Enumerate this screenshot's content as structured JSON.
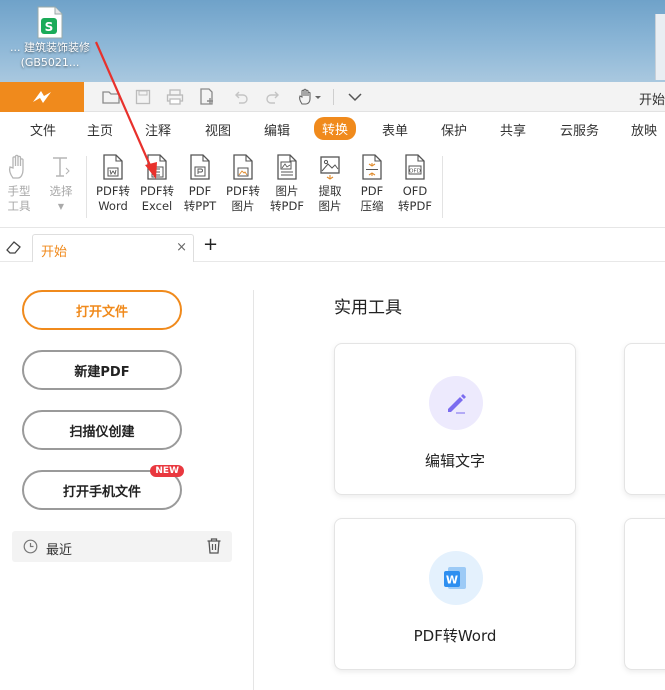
{
  "desktop": {
    "icon_label_line1": "建筑装饰装修",
    "icon_label_line2": "(GB5021...",
    "left_truncated": "..."
  },
  "titlebar": {
    "right_text": "开始"
  },
  "menu": {
    "items": [
      "文件",
      "主页",
      "注释",
      "视图",
      "编辑",
      "转换",
      "表单",
      "保护",
      "共享",
      "云服务",
      "放映"
    ],
    "active": "转换"
  },
  "toolbar": {
    "tools": [
      {
        "line1": "手型",
        "line2": "工具",
        "icon": "hand-icon",
        "disabled": true
      },
      {
        "line1": "选择",
        "line2": "",
        "icon": "text-select-icon",
        "disabled": true
      },
      {
        "line1": "PDF转",
        "line2": "Word",
        "icon": "pdf-to-word-icon"
      },
      {
        "line1": "PDF转",
        "line2": "Excel",
        "icon": "pdf-to-excel-icon"
      },
      {
        "line1": "PDF",
        "line2": "转PPT",
        "icon": "pdf-to-ppt-icon"
      },
      {
        "line1": "PDF转",
        "line2": "图片",
        "icon": "pdf-to-image-icon"
      },
      {
        "line1": "图片",
        "line2": "转PDF",
        "icon": "image-to-pdf-icon"
      },
      {
        "line1": "提取",
        "line2": "图片",
        "icon": "extract-image-icon"
      },
      {
        "line1": "PDF",
        "line2": "压缩",
        "icon": "pdf-compress-icon"
      },
      {
        "line1": "OFD",
        "line2": "转PDF",
        "icon": "ofd-to-pdf-icon"
      }
    ]
  },
  "tabs": {
    "doc_tab": "开始",
    "close": "×",
    "add": "+"
  },
  "left": {
    "open_file": "打开文件",
    "new_pdf": "新建PDF",
    "scanner": "扫描仪创建",
    "open_phone": "打开手机文件",
    "new_badge": "NEW",
    "recent": "最近"
  },
  "right": {
    "section_title": "实用工具",
    "cards": [
      {
        "label": "编辑文字",
        "icon": "edit-text-icon",
        "color": "#7b6cf0"
      },
      {
        "label": "PDF转Word",
        "icon": "word-icon",
        "color": "#2e8ff0"
      }
    ]
  },
  "colors": {
    "accent": "#f08a1c",
    "badge": "#e9383f"
  }
}
